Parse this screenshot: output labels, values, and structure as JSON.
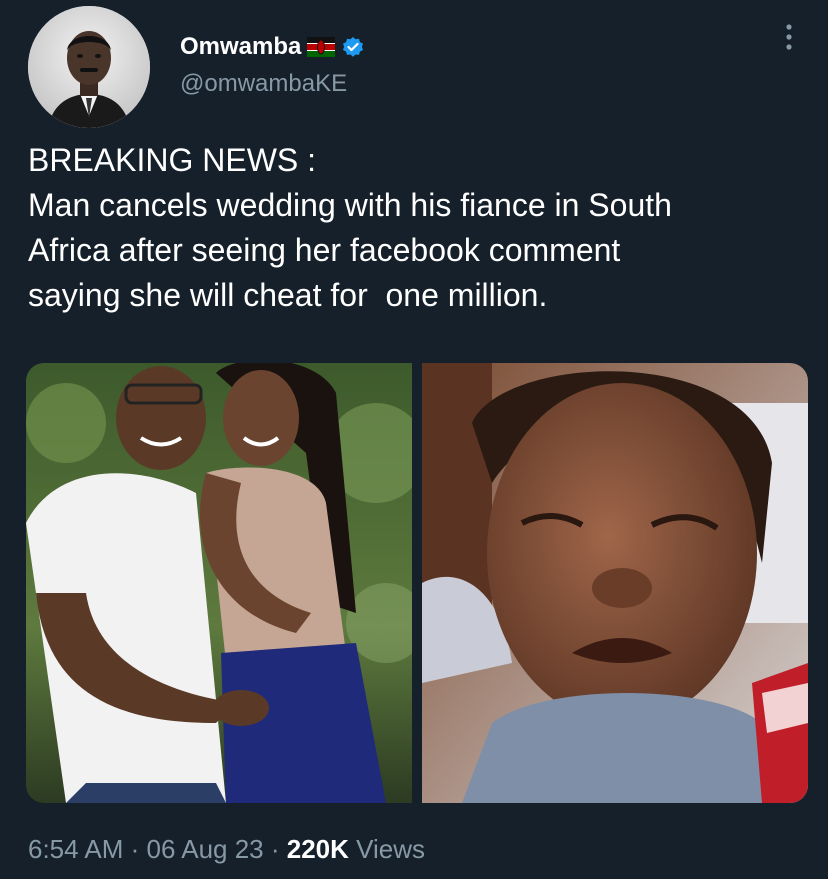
{
  "author": {
    "display_name": "Omwamba",
    "handle": "@omwambaKE",
    "flag_icon": "kenya-flag-icon",
    "verified_icon": "verified-badge-icon",
    "verified_color": "#1d9bf0"
  },
  "tweet": {
    "lines": [
      "BREAKING NEWS :",
      "Man cancels wedding with his fiance in South",
      "Africa after seeing her facebook comment",
      "saying she will cheat for  one million."
    ]
  },
  "meta": {
    "time": "6:54 AM",
    "separator": " · ",
    "date": "06 Aug 23",
    "views_count": "220K",
    "views_label": " Views"
  },
  "colors": {
    "background": "#15202b",
    "secondary_text": "#8899a6",
    "primary_text": "#ffffff"
  },
  "icons": {
    "more": "more-vertical-icon"
  }
}
